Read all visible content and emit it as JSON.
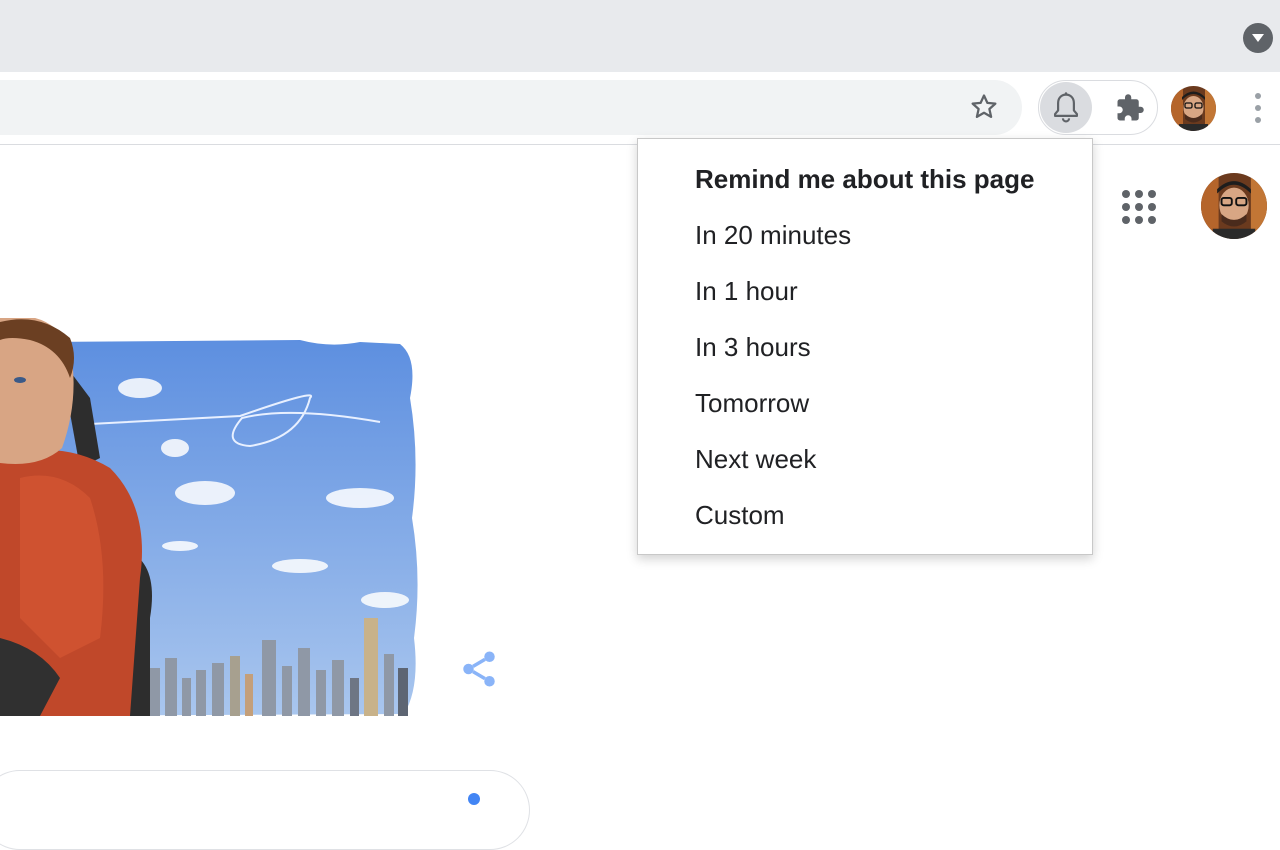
{
  "browser": {
    "tabstrip_color": "#e8eaed",
    "toolbar": {
      "bookmark_icon": "star-outline-icon",
      "reminder_icon": "bell-icon",
      "extensions_icon": "puzzle-piece-icon",
      "menu_icon": "kebab-menu-icon"
    }
  },
  "reminder_menu": {
    "title": "Remind me about this page",
    "options": [
      "In 20 minutes",
      "In 1 hour",
      "In 3 hours",
      "Tomorrow",
      "Next week",
      "Custom"
    ]
  },
  "page": {
    "apps_icon": "google-apps-grid-icon",
    "share_icon": "share-icon",
    "accent": "#4285f4"
  }
}
